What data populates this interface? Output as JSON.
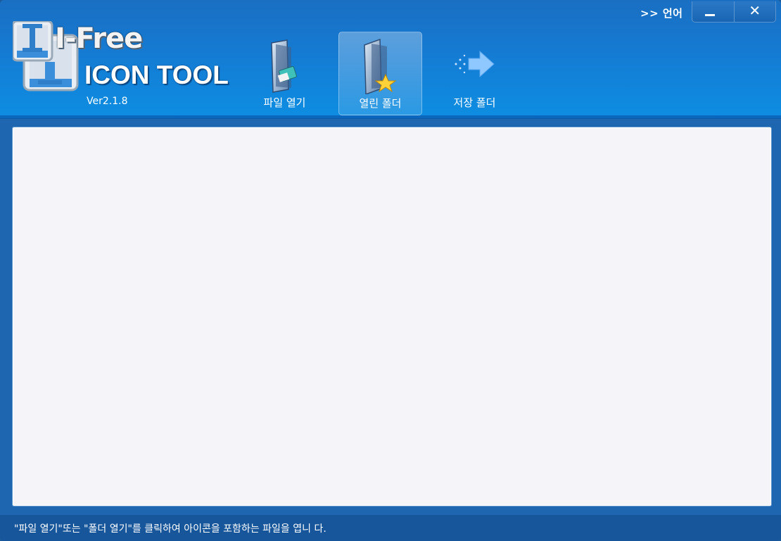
{
  "app": {
    "logo_prefix": "I-Free",
    "title": "ICON TOOL",
    "version": "Ver2.1.8"
  },
  "titlebar": {
    "language_label": ">> 언어",
    "minimize_icon": "minimize-icon",
    "close_label": "✕"
  },
  "toolbar": {
    "items": [
      {
        "label": "파일 열기",
        "icon": "file-open-icon",
        "active": false
      },
      {
        "label": "열린 폴더",
        "icon": "open-folder-icon",
        "active": true
      },
      {
        "label": "저장 폴더",
        "icon": "save-folder-icon",
        "active": false
      }
    ]
  },
  "status": {
    "text": "\"파일 열기\"또는 \"폴더 열기\"를 클릭하여 아이콘을 포함하는 파일을 엽니 다."
  },
  "colors": {
    "header": "#157bd3",
    "content_bg": "#f5f4f8",
    "status_bg": "#17569a"
  }
}
